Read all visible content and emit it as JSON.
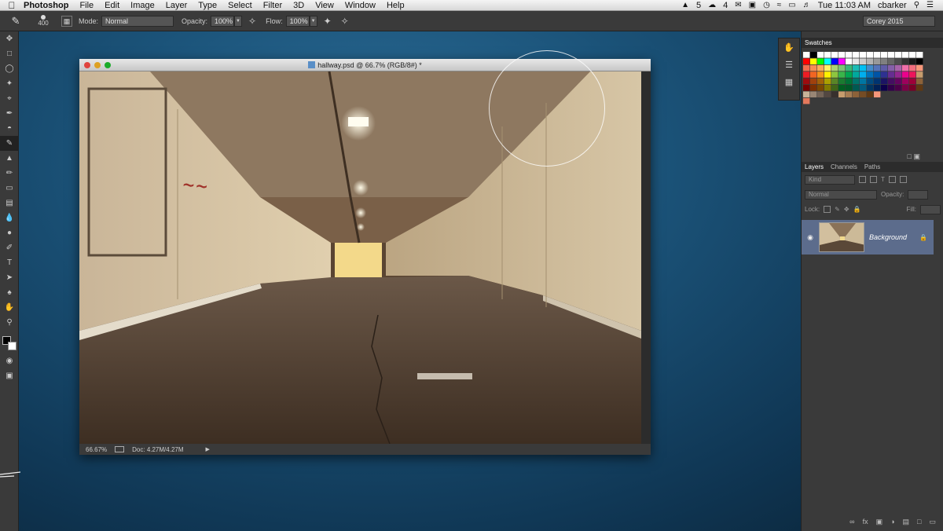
{
  "menubar": {
    "app_name": "Photoshop",
    "menus": [
      "File",
      "Edit",
      "Image",
      "Layer",
      "Type",
      "Select",
      "Filter",
      "3D",
      "View",
      "Window",
      "Help"
    ],
    "status_num_a": "5",
    "status_num_b": "4",
    "clock": "Tue 11:03 AM",
    "user": "cbarker"
  },
  "options": {
    "brush_size": "400",
    "mode_label": "Mode:",
    "mode_value": "Normal",
    "opacity_label": "Opacity:",
    "opacity_value": "100%",
    "flow_label": "Flow:",
    "flow_value": "100%",
    "preset": "Corey 2015"
  },
  "document": {
    "title": "hallway.psd @ 66.7% (RGB/8#) *",
    "zoom": "66.67%",
    "doc_size": "Doc: 4.27M/4.27M"
  },
  "panels": {
    "swatches_tab": "Swatches",
    "layers_tabs": [
      "Layers",
      "Channels",
      "Paths"
    ],
    "kind_label": "Kind",
    "blend_mode": "Normal",
    "opacity_label": "Opacity:",
    "lock_label": "Lock:",
    "fill_label": "Fill:",
    "layer_name": "Background"
  },
  "colors": {
    "accent_layer": "#5c6c8c",
    "bg_blue": "#1b5379"
  }
}
